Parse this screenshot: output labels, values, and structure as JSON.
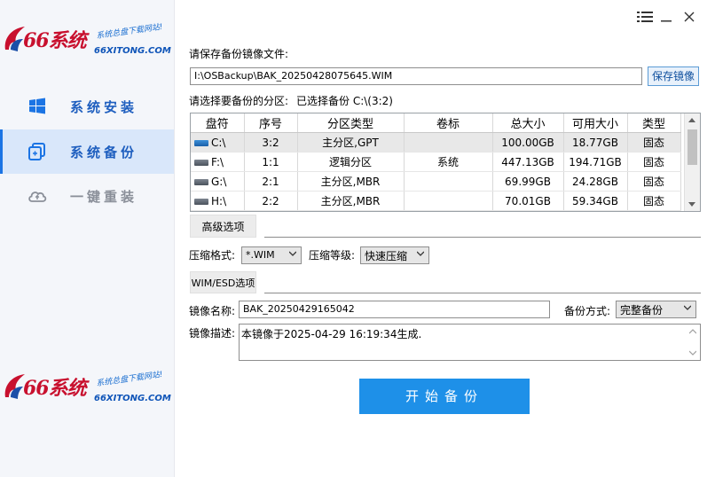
{
  "sidebar": {
    "logo": {
      "brand": "66系统",
      "slogan": "系统总盘下载网站!",
      "domain": "66XITONG.COM"
    },
    "items": [
      {
        "label": "系统安装",
        "icon": "windows-icon",
        "active": false
      },
      {
        "label": "系统备份",
        "icon": "backup-icon",
        "active": true
      },
      {
        "label": "一键重装",
        "icon": "cloud-icon",
        "active": false
      }
    ]
  },
  "window": {
    "menu_icon": "menu-icon",
    "minimize_icon": "minimize-icon",
    "close_icon": "close-icon"
  },
  "save": {
    "label": "请保存备份镜像文件:",
    "path": "I:\\OSBackup\\BAK_20250428075645.WIM",
    "button": "保存镜像"
  },
  "partition": {
    "label": "请选择要备份的分区:",
    "selected": "已选择备份 C:\\(3:2)",
    "columns": [
      "盘符",
      "序号",
      "分区类型",
      "卷标",
      "总大小",
      "可用大小",
      "类型"
    ],
    "rows": [
      {
        "drive": "C:\\",
        "index": "3:2",
        "type": "主分区,GPT",
        "label": "",
        "total": "100.00GB",
        "free": "18.77GB",
        "kind": "固态"
      },
      {
        "drive": "F:\\",
        "index": "1:1",
        "type": "逻辑分区",
        "label": "系统",
        "total": "447.13GB",
        "free": "194.71GB",
        "kind": "固态"
      },
      {
        "drive": "G:\\",
        "index": "2:1",
        "type": "主分区,MBR",
        "label": "",
        "total": "69.99GB",
        "free": "24.28GB",
        "kind": "固态"
      },
      {
        "drive": "H:\\",
        "index": "2:2",
        "type": "主分区,MBR",
        "label": "",
        "total": "70.01GB",
        "free": "59.34GB",
        "kind": "固态"
      }
    ]
  },
  "advanced": {
    "title": "高级选项",
    "format_label": "压缩格式:",
    "format_value": "*.WIM",
    "level_label": "压缩等级:",
    "level_value": "快速压缩"
  },
  "wim": {
    "title": "WIM/ESD选项",
    "name_label": "镜像名称:",
    "name_value": "BAK_20250429165042",
    "mode_label": "备份方式:",
    "mode_value": "完整备份",
    "desc_label": "镜像描述:",
    "desc_value": "本镜像于2025-04-29 16:19:34生成."
  },
  "start_button": "开始备份"
}
